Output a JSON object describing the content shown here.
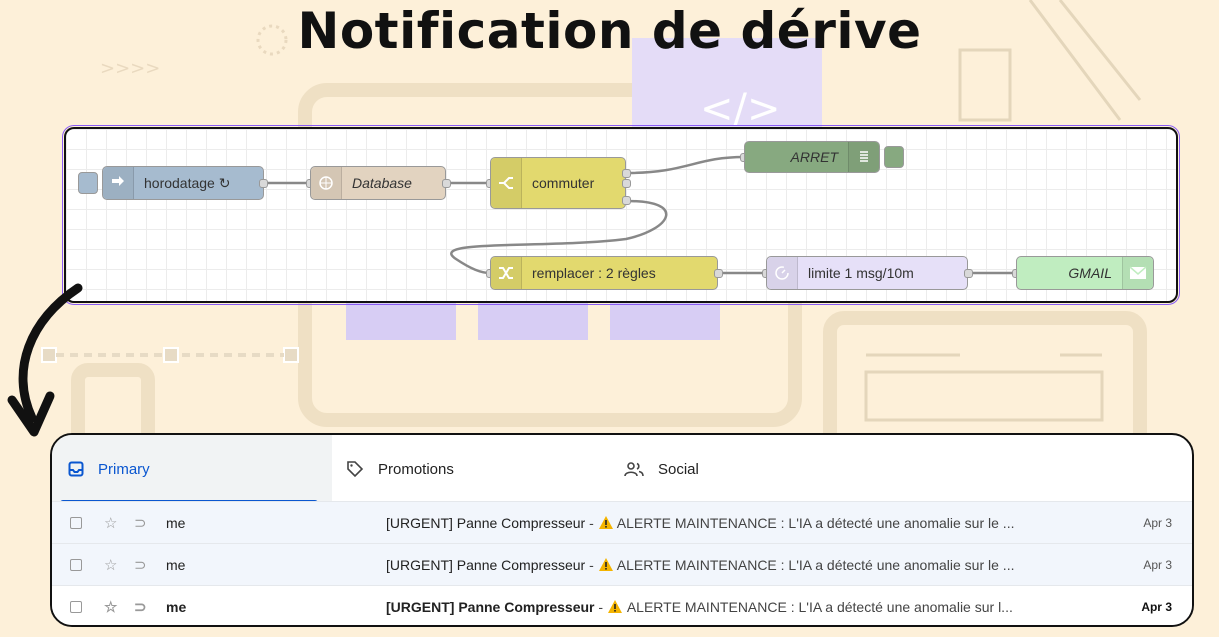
{
  "header": {
    "title": "Notification de dérive"
  },
  "flow": {
    "nodes": {
      "inject": {
        "label": "horodatage ↻",
        "icon": "arrow-right-icon",
        "color": "#a6bbcf"
      },
      "database": {
        "label": "Database",
        "icon": "database-icon",
        "color": "#e2d3c0"
      },
      "switch": {
        "label": "commuter",
        "icon": "switch-icon",
        "color": "#e2d96e"
      },
      "debug": {
        "label": "ARRET",
        "icon": "list-icon",
        "color": "#87a980"
      },
      "change": {
        "label": "remplacer : 2 règles",
        "icon": "shuffle-icon",
        "color": "#e2d96e"
      },
      "delay": {
        "label": "limite 1 msg/10m",
        "icon": "timer-icon",
        "color": "#e6e0f8"
      },
      "email": {
        "label": "GMAIL",
        "icon": "envelope-icon",
        "color": "#c0edc0"
      }
    }
  },
  "gmail": {
    "tabs": [
      {
        "label": "Primary",
        "icon": "inbox-icon",
        "active": true
      },
      {
        "label": "Promotions",
        "icon": "tag-icon",
        "active": false
      },
      {
        "label": "Social",
        "icon": "people-icon",
        "active": false
      }
    ],
    "rows": [
      {
        "sender": "me",
        "subject": "[URGENT] Panne Compresseur",
        "separator": " - ",
        "snippet": "ALERTE MAINTENANCE : L'IA a détecté une anomalie sur le ...",
        "date": "Apr 3",
        "unread": false
      },
      {
        "sender": "me",
        "subject": "[URGENT] Panne Compresseur",
        "separator": " - ",
        "snippet": "ALERTE MAINTENANCE : L'IA a détecté une anomalie sur le ...",
        "date": "Apr 3",
        "unread": false
      },
      {
        "sender": "me",
        "subject": "[URGENT] Panne Compresseur",
        "separator": " - ",
        "snippet": "ALERTE MAINTENANCE : L'IA a détecté une anomalie sur l...",
        "date": "Apr 3",
        "unread": true
      }
    ]
  },
  "colors": {
    "accent": "#0b57d0",
    "background": "#fdf0d9",
    "warning": "#f4b400"
  }
}
